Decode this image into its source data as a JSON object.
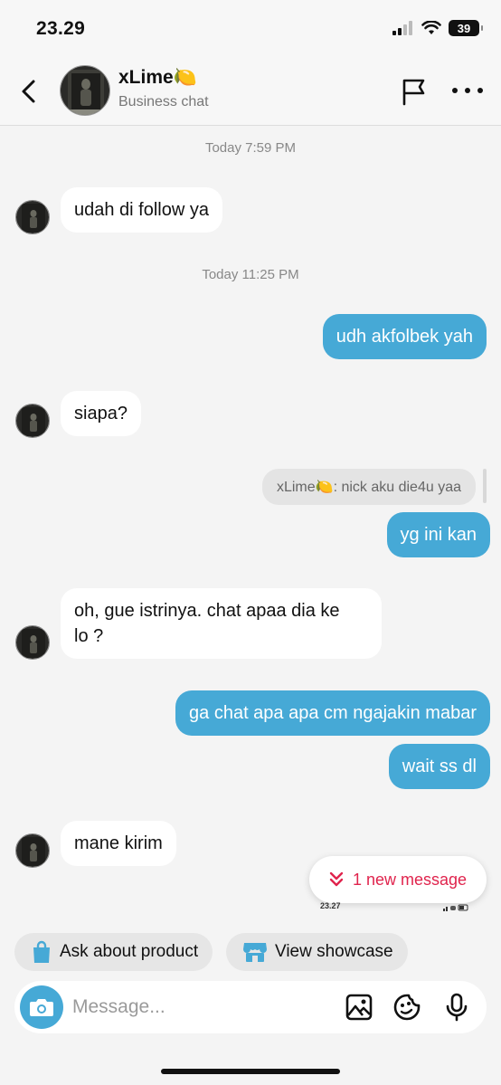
{
  "status_bar": {
    "time": "23.29",
    "battery": "39"
  },
  "header": {
    "name": "xLime🍋",
    "subtitle": "Business chat"
  },
  "messages": {
    "ts1": "Today 7:59 PM",
    "m1": "udah di follow ya",
    "ts2": "Today 11:25 PM",
    "m2": "udh akfolbek yah",
    "m3": "siapa?",
    "quote": "xLime🍋: nick aku die4u yaa",
    "m4": "yg ini kan",
    "m5_line1": "oh, gue istrinya. chat apaa dia ke",
    "m5_line2": "lo ?",
    "m6": "ga chat apa apa cm ngajakin mabar",
    "m7": "wait ss dl",
    "m8": "mane kirim"
  },
  "new_message": {
    "label": "1 new message"
  },
  "mini_status": {
    "time": "23.27"
  },
  "chips": {
    "ask_product": "Ask about product",
    "view_showcase": "View showcase"
  },
  "input": {
    "placeholder": "Message..."
  },
  "colors": {
    "accent_blue": "#46a9d6",
    "alert_red": "#e0244d"
  }
}
